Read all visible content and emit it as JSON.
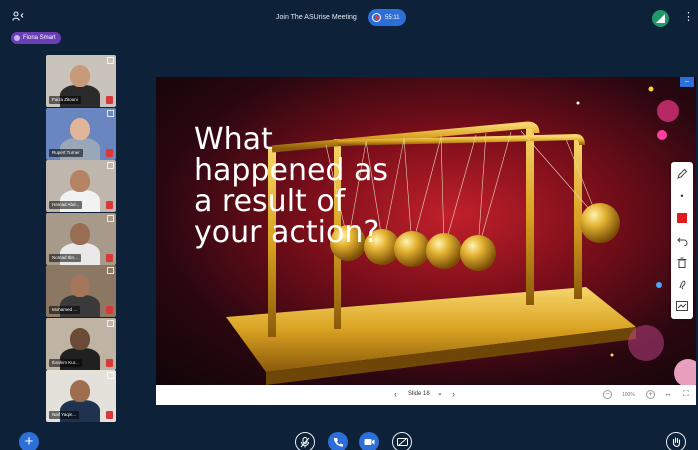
{
  "header": {
    "meeting_title": "Join The ASUrise Meeting",
    "recording_time": "55:11",
    "user_chip": "Fiona Smart"
  },
  "participants": [
    {
      "name": "Faiza Zitouni",
      "bg": "#c9c3bb",
      "skin": "#c99a7a",
      "shirt": "#2b2b2b"
    },
    {
      "name": "Rupert Turner",
      "bg": "#6a86c0",
      "skin": "#e0b59a",
      "shirt": "#9aa7b8"
    },
    {
      "name": "Hamad Abd...",
      "bg": "#bfb7ad",
      "skin": "#b58463",
      "shirt": "#f2f2f2"
    },
    {
      "name": "Nomad Ibn...",
      "bg": "#a79a8a",
      "skin": "#9a6e52",
      "shirt": "#e9e9e9"
    },
    {
      "name": "Mohamed ...",
      "bg": "#8c7862",
      "skin": "#a5775a",
      "shirt": "#3a3a3a"
    },
    {
      "name": "Ibrahim Kur...",
      "bg": "#bfb4a4",
      "skin": "#6b4b38",
      "shirt": "#202020"
    },
    {
      "name": "Naif Yaqin...",
      "bg": "#e4e0da",
      "skin": "#9e6e4e",
      "shirt": "#1f3350"
    }
  ],
  "slide": {
    "text": "What\nhappened as\na result of\nyour action?"
  },
  "slide_nav": {
    "prev": "‹",
    "label": "Slide 18",
    "caret": "⌄",
    "next": "›",
    "zoom": "100%",
    "zoom_minus": "−",
    "zoom_plus": "+",
    "fit": "↔",
    "fullscreen": "⛶"
  },
  "colors": {
    "accent": "#2d6fd8",
    "background": "#0d2138",
    "chip": "#6a3fb5",
    "draw_color": "#e01b1b"
  },
  "icons": {
    "users": "users-icon",
    "more": "kebab-icon",
    "add": "plus-icon",
    "mic": "mic-icon",
    "phone": "phone-icon",
    "camera": "camera-icon",
    "share": "screenshare-icon",
    "hand": "raise-hand-icon"
  }
}
